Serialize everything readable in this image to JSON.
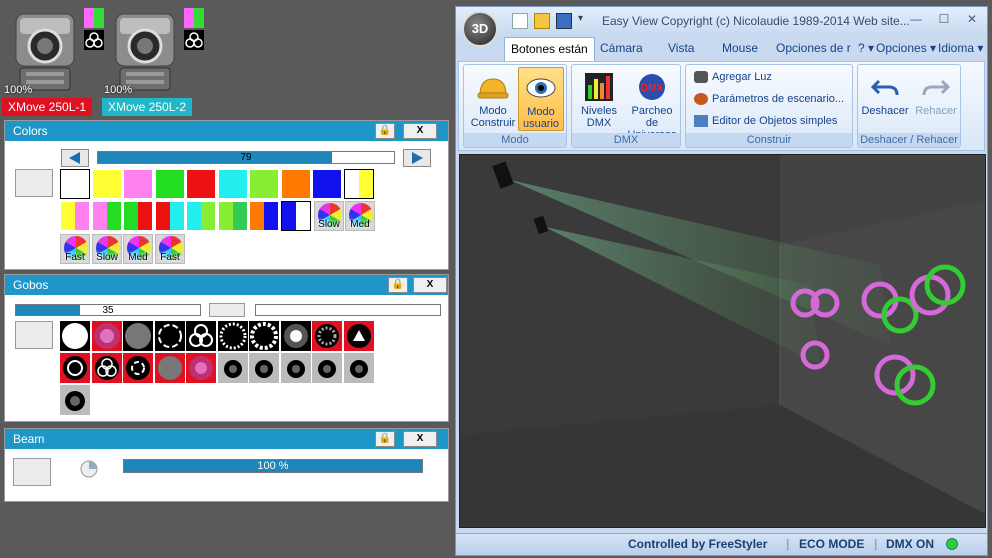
{
  "fixtures": [
    {
      "label": "XMove 250L-1",
      "pct": "100%",
      "label_color": "#e01020",
      "swatch": [
        "#ff66ff",
        "#33dd33"
      ]
    },
    {
      "label": "XMove 250L-2",
      "pct": "100%",
      "label_color": "#20b8c8",
      "swatch": [
        "#ff66ff",
        "#33dd33"
      ]
    }
  ],
  "colors_panel": {
    "title": "Colors",
    "slider_value": "79",
    "slider_fraction": 0.79,
    "close_label": "X",
    "wheel_buttons": [
      "Slow",
      "Med",
      "Fast",
      "Slow",
      "Med",
      "Fast"
    ]
  },
  "gobos_panel": {
    "title": "Gobos",
    "slider_value": "35",
    "slider_fraction": 0.35,
    "close_label": "X"
  },
  "beam_panel": {
    "title": "Beam",
    "progress_text": "100 %",
    "progress_fraction": 1.0,
    "close_label": "X"
  },
  "app": {
    "orb_label": "3D",
    "title": "Easy View  Copyright (c) Nicolaudie 1989-2014   Web site...",
    "tabs": [
      "Botones están",
      "Cámara",
      "Vista",
      "Mouse",
      "Opciones de r"
    ],
    "help_label": "?",
    "options_label": "Opciones",
    "language_label": "Idioma",
    "groups": {
      "modo": {
        "label": "Modo",
        "buttons": [
          {
            "line1": "Modo",
            "line2": "Construir"
          },
          {
            "line1": "Modo",
            "line2": "usuario"
          }
        ]
      },
      "dmx": {
        "label": "DMX",
        "buttons": [
          {
            "line1": "Niveles",
            "line2": "DMX"
          },
          {
            "line1": "Parcheo de",
            "line2": "Universos"
          }
        ]
      },
      "construir": {
        "label": "Construir",
        "items": [
          "Agregar Luz",
          "Parámetros de escenario...",
          "Editor de Objetos simples"
        ]
      },
      "undo": {
        "label": "Deshacer / Rehacer",
        "undo": "Deshacer",
        "redo": "Rehacer"
      }
    },
    "status": {
      "controlled": "Controlled by FreeStyler",
      "eco": "ECO MODE",
      "dmx": "DMX ON",
      "dmx_indicator_color": "#2ecc40"
    }
  },
  "colors": {
    "accent": "#1e96c8",
    "desktop": "#5a5a5a"
  }
}
